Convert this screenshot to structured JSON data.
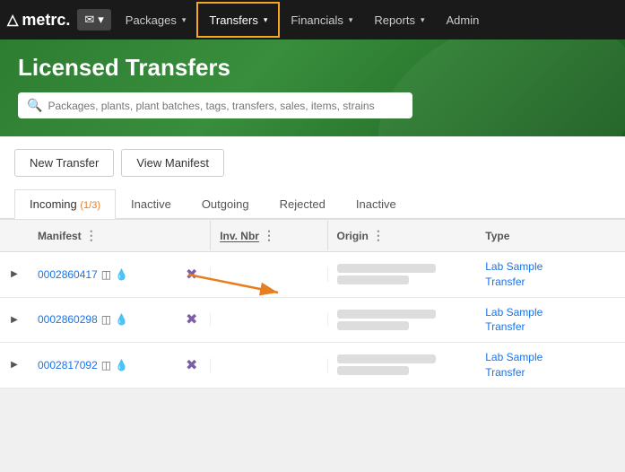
{
  "navbar": {
    "logo": "metrc.",
    "mail_label": "✉",
    "items": [
      {
        "id": "packages",
        "label": "Packages",
        "active": false
      },
      {
        "id": "transfers",
        "label": "Transfers",
        "active": true
      },
      {
        "id": "financials",
        "label": "Financials",
        "active": false
      },
      {
        "id": "reports",
        "label": "Reports",
        "active": false
      },
      {
        "id": "admin",
        "label": "Admin",
        "active": false
      }
    ]
  },
  "page": {
    "title": "Licensed Transfers",
    "search_placeholder": "Packages, plants, plant batches, tags, transfers, sales, items, strains"
  },
  "toolbar": {
    "new_transfer": "New Transfer",
    "view_manifest": "View Manifest"
  },
  "tabs": [
    {
      "id": "incoming",
      "label": "Incoming",
      "badge": "1/3",
      "active": true
    },
    {
      "id": "inactive1",
      "label": "Inactive",
      "active": false
    },
    {
      "id": "outgoing",
      "label": "Outgoing",
      "active": false
    },
    {
      "id": "rejected",
      "label": "Rejected",
      "active": false
    },
    {
      "id": "inactive2",
      "label": "Inactive",
      "active": false
    }
  ],
  "table": {
    "columns": [
      {
        "id": "expand",
        "label": ""
      },
      {
        "id": "manifest",
        "label": "Manifest"
      },
      {
        "id": "invnbr",
        "label": "Inv. Nbr"
      },
      {
        "id": "origin",
        "label": "Origin"
      },
      {
        "id": "type",
        "label": "Type"
      }
    ],
    "rows": [
      {
        "id": "row1",
        "manifest": "0002860417",
        "invnbr": "",
        "origin_lines": [
          "████████████",
          "████████"
        ],
        "type_line1": "Lab Sample",
        "type_line2": "Transfer"
      },
      {
        "id": "row2",
        "manifest": "0002860298",
        "invnbr": "",
        "origin_lines": [
          "████████████",
          "████████"
        ],
        "type_line1": "Lab Sample",
        "type_line2": "Transfer"
      },
      {
        "id": "row3",
        "manifest": "0002817092",
        "invnbr": "",
        "origin_lines": [
          "████████████",
          "████████"
        ],
        "type_line1": "Lab Sample",
        "type_line2": "Transfer"
      }
    ]
  }
}
